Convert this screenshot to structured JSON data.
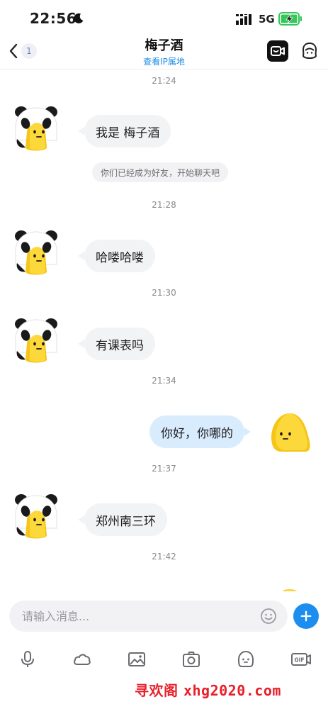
{
  "status_bar": {
    "time": "22:56",
    "network": "5G",
    "icons": [
      "moon-icon",
      "signal-icon",
      "battery-charging-icon"
    ]
  },
  "nav": {
    "back_badge": "1",
    "title": "梅子酒",
    "subtitle": "查看IP属地",
    "icons": [
      "back-chevron-icon",
      "video-call-icon",
      "profile-icon"
    ]
  },
  "chat": {
    "messages": [
      {
        "type": "timestamp",
        "text": "21:24"
      },
      {
        "type": "incoming",
        "text": "我是 梅子酒"
      },
      {
        "type": "notice",
        "text": "你们已经成为好友，开始聊天吧"
      },
      {
        "type": "timestamp",
        "text": "21:28"
      },
      {
        "type": "incoming",
        "text": "哈喽哈喽"
      },
      {
        "type": "timestamp",
        "text": "21:30"
      },
      {
        "type": "incoming",
        "text": "有课表吗"
      },
      {
        "type": "timestamp",
        "text": "21:34"
      },
      {
        "type": "outgoing",
        "text": "你好，你哪的"
      },
      {
        "type": "timestamp",
        "text": "21:37"
      },
      {
        "type": "incoming",
        "text": "郑州南三环"
      },
      {
        "type": "timestamp",
        "text": "21:42"
      },
      {
        "type": "outgoing",
        "text": ""
      }
    ]
  },
  "input": {
    "placeholder": "请输入消息...",
    "value": ""
  },
  "toolbar": {
    "items": [
      "microphone-icon",
      "cloud-icon",
      "image-icon",
      "camera-icon",
      "sticker-icon",
      "gif-icon"
    ],
    "gif_label": "GIF"
  },
  "watermark": {
    "text_cn": "寻欢阁",
    "text_site": "xhg2020.com"
  },
  "colors": {
    "accent": "#1b8ef0",
    "incoming_bubble": "#f2f3f5",
    "outgoing_bubble": "#d9ecfe",
    "watermark": "#e8202a"
  }
}
